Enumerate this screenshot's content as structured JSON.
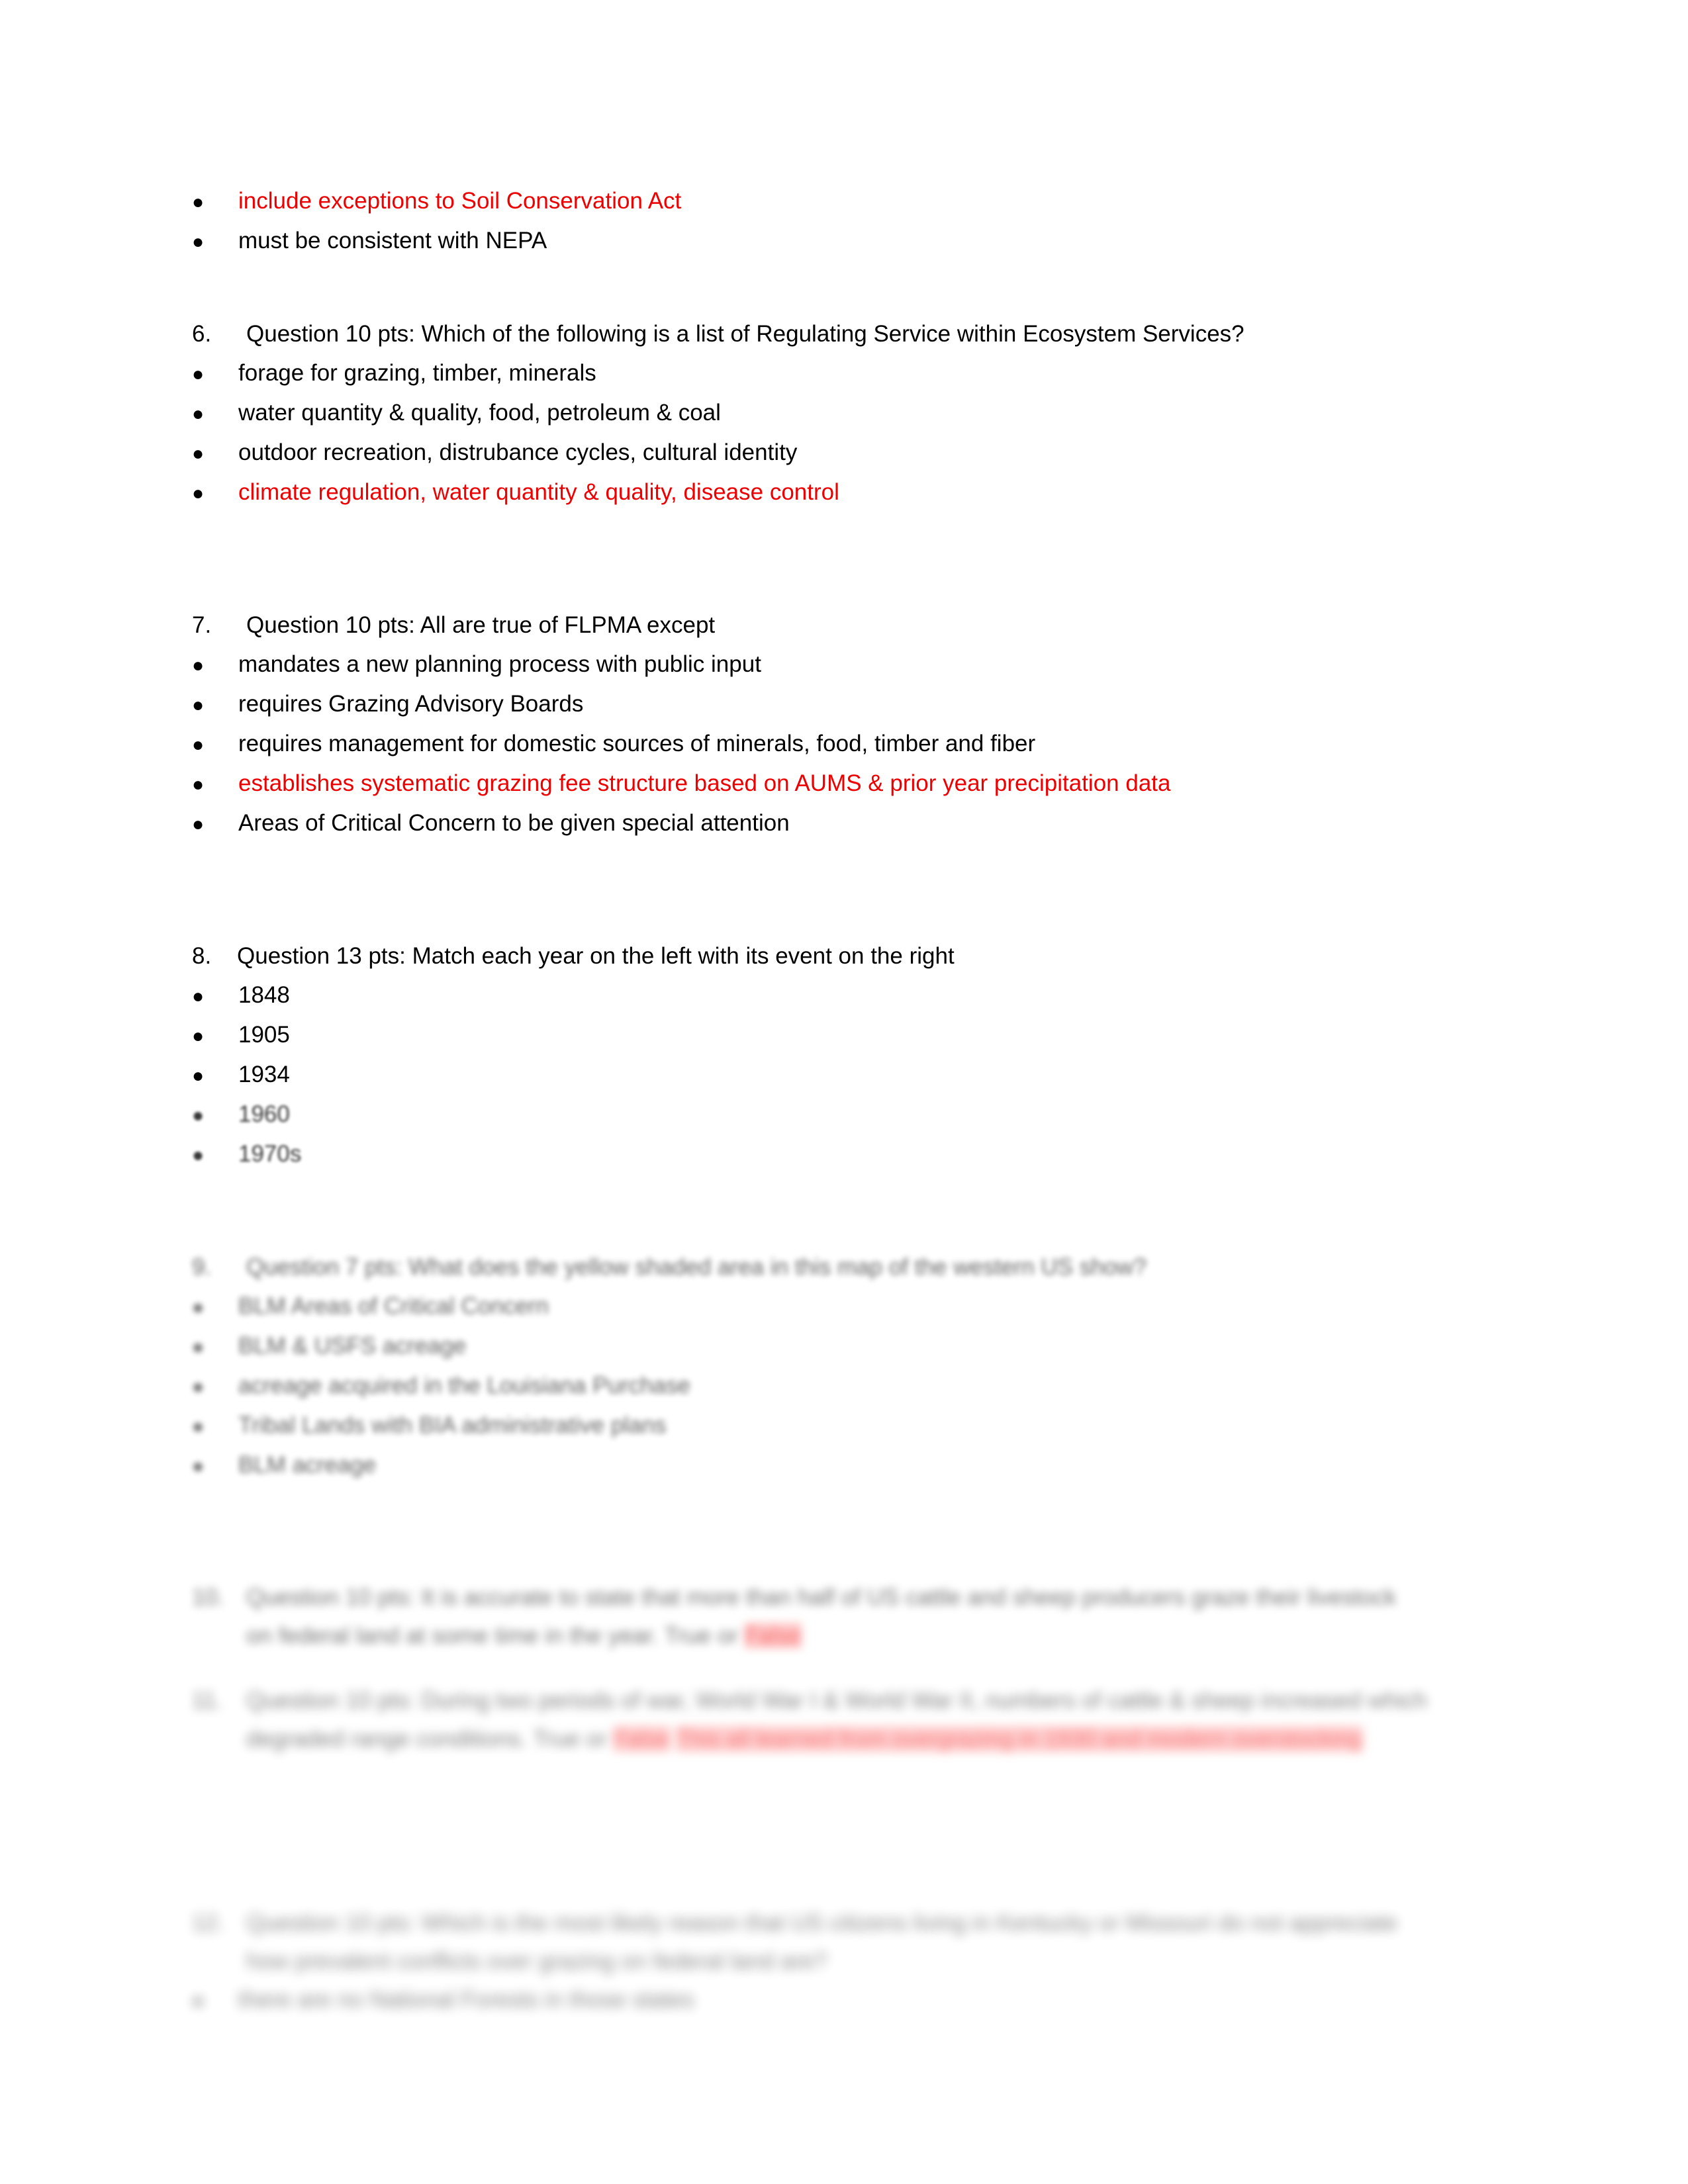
{
  "document": {
    "type": "exam-answer-key",
    "page_background": "#ffffff",
    "text_color": "#000000",
    "answer_color": "#ee0000",
    "highlight_color": "#ff9a9a"
  },
  "top_options": {
    "items": [
      {
        "text": "include exceptions to Soil Conservation Act",
        "is_answer": true
      },
      {
        "text": "must be consistent with NEPA",
        "is_answer": false
      }
    ]
  },
  "questions": [
    {
      "number": "6.",
      "prompt": "Question 10 pts:  Which of the following is a list of Regulating Service within Ecosystem Services?",
      "options": [
        {
          "text": "forage for grazing, timber, minerals",
          "is_answer": false
        },
        {
          "text": "water quantity & quality, food, petroleum & coal",
          "is_answer": false
        },
        {
          "text": "outdoor recreation, distrubance cycles, cultural identity",
          "is_answer": false
        },
        {
          "text": "climate regulation, water quantity & quality, disease control",
          "is_answer": true
        }
      ]
    },
    {
      "number": "7.",
      "prompt": "Question 10 pts:  All are true of FLPMA except",
      "options": [
        {
          "text": "mandates a new planning process with public input",
          "is_answer": false
        },
        {
          "text": "requires Grazing Advisory Boards",
          "is_answer": false
        },
        {
          "text": "requires management for domestic sources of minerals, food, timber and fiber",
          "is_answer": false
        },
        {
          "text": "establishes systematic grazing fee structure based on AUMS & prior year precipitation data",
          "is_answer": true
        },
        {
          "text": "Areas of Critical Concern to be given special attention",
          "is_answer": false
        }
      ]
    },
    {
      "number": "8.",
      "prompt": "Question 13 pts:  Match each year on the left with its event on the right",
      "options": [
        {
          "text": "1848",
          "is_answer": false
        },
        {
          "text": "1905",
          "is_answer": false
        },
        {
          "text": "1934",
          "is_answer": false
        },
        {
          "text": "1960",
          "is_answer": false,
          "blur": "a"
        },
        {
          "text": "1970s",
          "is_answer": false,
          "blur": "a"
        }
      ]
    },
    {
      "number": "9.",
      "prompt": "Question 7 pts:  What does the yellow shaded area in this map of the western US show?",
      "blur": "b",
      "options": [
        {
          "text": "BLM Areas of Critical Concern",
          "is_answer": false
        },
        {
          "text": "BLM & USFS acreage",
          "is_answer": false
        },
        {
          "text": "acreage acquired in the Louisiana Purchase",
          "is_answer": false
        },
        {
          "text": "Tribal Lands with BIA administrative plans",
          "is_answer": false
        },
        {
          "text": "BLM acreage",
          "is_answer": false
        }
      ]
    },
    {
      "number": "10.",
      "prompt": "Question 10 pts:  It is accurate to state that more than half of US cattle and sheep producers graze their livestock on federal land at some time in the year.  True or",
      "answer_inline": "False",
      "blur": "c",
      "options": []
    },
    {
      "number": "11.",
      "prompt": "Question 10 pts:  During two periods of war, World War I & World War II, numbers of cattle & sheep increased which degraded range conditions.   True or",
      "answer_inline": "False",
      "answer_note": "This all learned from overgrazing in 1930 and modern overstocking",
      "blur": "d",
      "options": []
    },
    {
      "number": "12.",
      "prompt": "Question 10 pts:  Which is the most likely reason that US citizens living in Kentucky or Missouri do not appreciate how prevalent conflicts over grazing on federal land are?",
      "blur": "e",
      "options": [
        {
          "text": "there are no National Forests in those states",
          "is_answer": false
        }
      ]
    }
  ]
}
